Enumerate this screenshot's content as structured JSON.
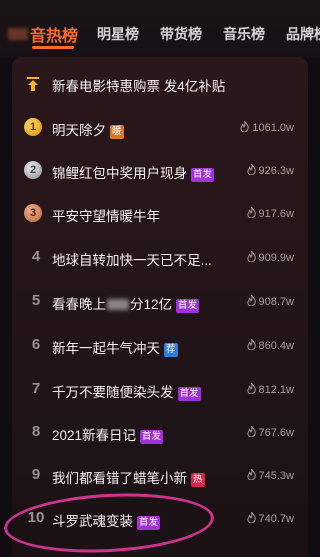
{
  "tabs": [
    {
      "label": "音热榜",
      "active": true
    },
    {
      "label": "明星榜"
    },
    {
      "label": "带货榜"
    },
    {
      "label": "音乐榜"
    },
    {
      "label": "品牌榜"
    }
  ],
  "pinned": {
    "title": "新春电影特惠购票 发4亿补贴"
  },
  "rows": [
    {
      "rank": "1",
      "title": "明天除夕",
      "badge": "暖",
      "badge_type": "warm",
      "heat": "1061.0w"
    },
    {
      "rank": "2",
      "title": "锦鲤红包中奖用户现身",
      "badge": "首发",
      "badge_type": "first",
      "heat": "926.3w"
    },
    {
      "rank": "3",
      "title": "平安守望情暖牛年",
      "badge": "",
      "badge_type": "",
      "heat": "917.6w"
    },
    {
      "rank": "4",
      "title": "地球自转加快一天已不足...",
      "badge": "",
      "badge_type": "",
      "heat": "909.9w"
    },
    {
      "rank": "5",
      "title_pre": "看春晚上",
      "title_post": "分12亿",
      "badge": "首发",
      "badge_type": "first",
      "heat": "908.7w"
    },
    {
      "rank": "6",
      "title": "新年一起牛气冲天",
      "badge": "荐",
      "badge_type": "recommend",
      "heat": "860.4w"
    },
    {
      "rank": "7",
      "title": "千万不要随便染头发",
      "badge": "首发",
      "badge_type": "first",
      "heat": "812.1w"
    },
    {
      "rank": "8",
      "title": "2021新春日记",
      "badge": "首发",
      "badge_type": "first",
      "heat": "767.6w"
    },
    {
      "rank": "9",
      "title": "我们都看错了蜡笔小新",
      "badge": "热",
      "badge_type": "hot",
      "heat": "745.3w"
    },
    {
      "rank": "10",
      "title": "斗罗武魂变装",
      "badge": "首发",
      "badge_type": "first",
      "heat": "740.7w"
    }
  ],
  "colors": {
    "accent": "#ff6a2a",
    "badge_first": "#a133d6",
    "badge_warm": "#d6782a",
    "badge_recommend": "#2b7fd8",
    "badge_hot": "#d8284a",
    "annotation": "#e0389a"
  },
  "icons": {
    "pin": "pin-top-icon",
    "flame": "flame-icon",
    "medal": "medal-icon"
  }
}
